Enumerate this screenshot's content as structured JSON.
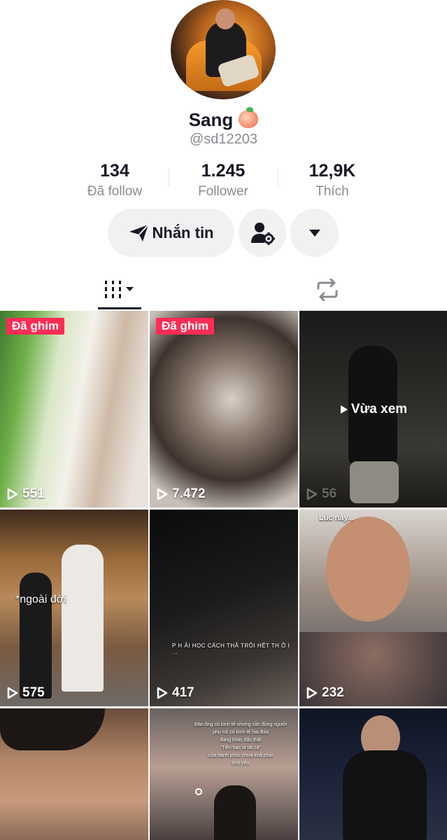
{
  "profile": {
    "display_name": "Sang",
    "name_emoji_icon": "peach-emoji-icon",
    "handle": "@sd12203"
  },
  "stats": [
    {
      "value": "134",
      "label": "Đã follow"
    },
    {
      "value": "1.245",
      "label": "Follower"
    },
    {
      "value": "12,9K",
      "label": "Thích"
    }
  ],
  "actions": {
    "message_label": "Nhắn tin",
    "message_icon": "send-icon",
    "add_friend_icon": "person-settings-icon",
    "more_icon": "caret-down-icon"
  },
  "tabs": {
    "videos_icon": "videos-grid-icon",
    "repost_icon": "repost-icon"
  },
  "videos": [
    {
      "pinned": "Đã ghim",
      "views": "551"
    },
    {
      "pinned": "Đã ghim",
      "views": "7.472"
    },
    {
      "recent": "Vừa xem",
      "views": "56"
    },
    {
      "caption": "*ngoài đời",
      "views": "575"
    },
    {
      "caption": "P H ẢI HỌC CÁCH THẢ TRÔI HẾT  TH Ô I ...",
      "views": "417"
    },
    {
      "caption": "Lúc này...",
      "views": "232"
    },
    {},
    {
      "caption": "Đàn ông có kinh tế nhưng cần đúng người\nphụ nữ có kinh tế hai đứa\nđang khác đặc thật\n\"Tiền bạc là tất cả\"\ncủa hạnh phúc chưa khả phải\ntình yêu"
    },
    {}
  ],
  "colors": {
    "pinned_badge": "#fe2c55",
    "button_bg": "#f1f1f2",
    "text_primary": "#161823",
    "text_secondary": "#8a8b91"
  }
}
